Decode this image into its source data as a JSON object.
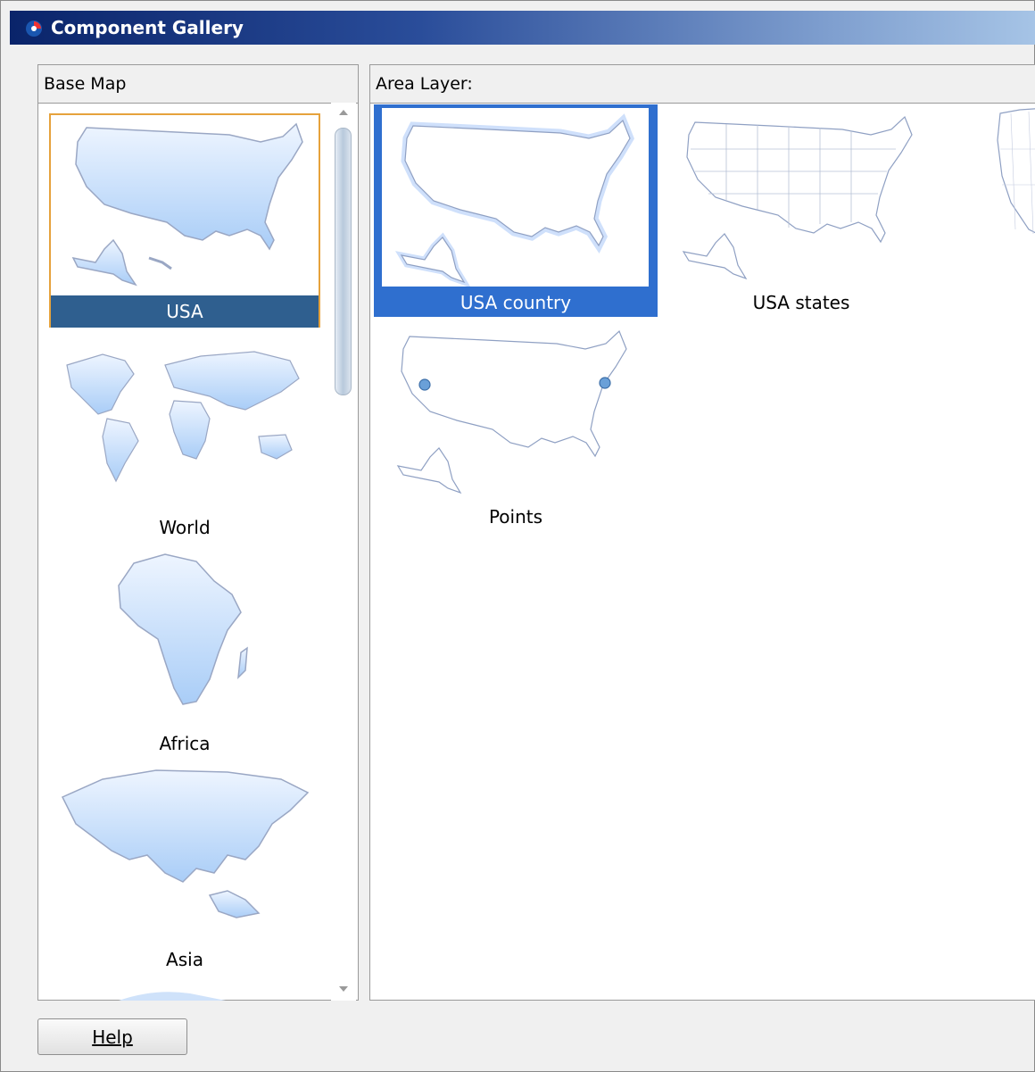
{
  "window": {
    "title": "Component Gallery"
  },
  "base_map": {
    "title": "Base Map",
    "items": [
      {
        "label": "USA",
        "selected": true
      },
      {
        "label": "World",
        "selected": false
      },
      {
        "label": "Africa",
        "selected": false
      },
      {
        "label": "Asia",
        "selected": false
      }
    ]
  },
  "area_layer": {
    "title": "Area Layer:",
    "items": [
      {
        "label": "USA country",
        "selected": true
      },
      {
        "label": "USA states",
        "selected": false
      },
      {
        "label": "Points",
        "selected": false
      }
    ]
  },
  "footer": {
    "help_label": "Help"
  },
  "colors": {
    "title_bar_start": "#0a246a",
    "title_bar_end": "#a6c4e6",
    "left_selection_border": "#e6a23c",
    "left_selection_label_bg": "#2f5f8f",
    "right_selection_bg": "#2f6fcf",
    "map_fill": "#bcd7f8",
    "map_stroke": "#9aa7c4"
  }
}
